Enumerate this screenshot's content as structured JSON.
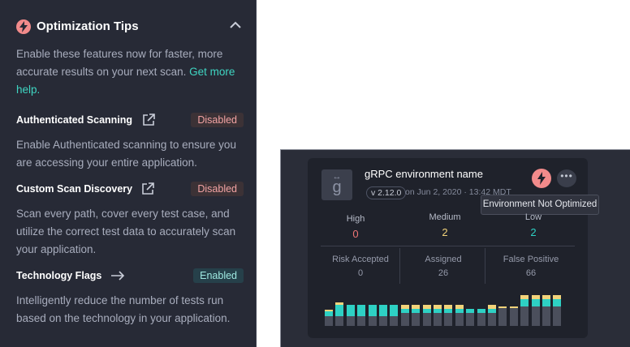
{
  "tips": {
    "title": "Optimization Tips",
    "intro_text": "Enable these features now for faster, more accurate results on your next scan. ",
    "intro_link": "Get more help.",
    "features": [
      {
        "name": "Authenticated Scanning",
        "icon": "external-link-icon",
        "status": "Disabled",
        "description": "Enable Authenticated scanning to ensure you are accessing your entire application."
      },
      {
        "name": "Custom Scan Discovery",
        "icon": "external-link-icon",
        "status": "Disabled",
        "description": "Scan every path, cover every test case, and utilize the correct test data to accurately scan your application."
      },
      {
        "name": "Technology Flags",
        "icon": "arrow-right-icon",
        "status": "Enabled",
        "description": "Intelligently reduce the number of tests run based on the technology in your application."
      }
    ]
  },
  "environment": {
    "logo_letter": "g",
    "logo_arrows": "↔",
    "name": "gRPC environment name",
    "version": "v 2.12.0",
    "date": "on Jun 2, 2020 · 13:42 MDT",
    "more_label": "•••",
    "tooltip": "Environment Not Optimized",
    "severity": [
      {
        "label": "High",
        "value": "0",
        "color": "#f07575"
      },
      {
        "label": "Medium",
        "value": "2",
        "color": "#f2d37a"
      },
      {
        "label": "Low",
        "value": "2",
        "color": "#2ed1c4"
      }
    ],
    "stats": [
      {
        "label": "Risk Accepted",
        "value": "0"
      },
      {
        "label": "Assigned",
        "value": "26"
      },
      {
        "label": "False Positive",
        "value": "66"
      }
    ],
    "history": [
      {
        "gray": 12,
        "teal": 6,
        "yellow": 2
      },
      {
        "gray": 12,
        "teal": 14,
        "yellow": 3
      },
      {
        "gray": 12,
        "teal": 14,
        "yellow": 0
      },
      {
        "gray": 12,
        "teal": 14,
        "yellow": 0
      },
      {
        "gray": 12,
        "teal": 14,
        "yellow": 0
      },
      {
        "gray": 12,
        "teal": 14,
        "yellow": 0
      },
      {
        "gray": 12,
        "teal": 14,
        "yellow": 0
      },
      {
        "gray": 16,
        "teal": 5,
        "yellow": 5
      },
      {
        "gray": 16,
        "teal": 5,
        "yellow": 5
      },
      {
        "gray": 16,
        "teal": 5,
        "yellow": 5
      },
      {
        "gray": 16,
        "teal": 5,
        "yellow": 5
      },
      {
        "gray": 16,
        "teal": 5,
        "yellow": 5
      },
      {
        "gray": 16,
        "teal": 5,
        "yellow": 5
      },
      {
        "gray": 16,
        "teal": 5,
        "yellow": 0
      },
      {
        "gray": 16,
        "teal": 5,
        "yellow": 0
      },
      {
        "gray": 16,
        "teal": 5,
        "yellow": 5
      },
      {
        "gray": 22,
        "teal": 0,
        "yellow": 2
      },
      {
        "gray": 22,
        "teal": 0,
        "yellow": 2
      },
      {
        "gray": 24,
        "teal": 9,
        "yellow": 5
      },
      {
        "gray": 24,
        "teal": 9,
        "yellow": 5
      },
      {
        "gray": 24,
        "teal": 9,
        "yellow": 5
      },
      {
        "gray": 24,
        "teal": 9,
        "yellow": 5
      }
    ],
    "colors": {
      "gray": "#4b4f5c",
      "teal": "#2ed1c4",
      "yellow": "#f2d37a"
    }
  }
}
